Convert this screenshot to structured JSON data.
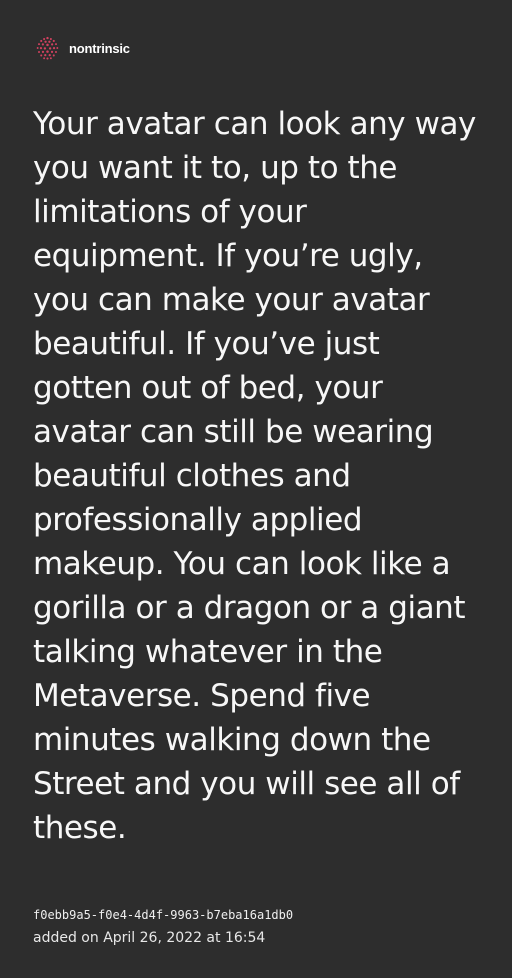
{
  "header": {
    "brand_name": "nontrinsic",
    "logo_icon": "pink-dotted-globe-icon",
    "logo_color": "#d1415f"
  },
  "post": {
    "text": "Your avatar can look any way you want it to, up to the limitations of your equipment. If you’re ugly, you can make your avatar beautiful. If you’ve just gotten out of bed, your avatar can still be wearing beautiful clothes and professionally applied makeup. You can look like a gorilla or a dragon or a giant talking whatever in the Metaverse. Spend five minutes walking down the Street and you will see all of these."
  },
  "footer": {
    "id": "f0ebb9a5-f0e4-4d4f-9963-b7eba16a1db0",
    "added_text": "added on April 26, 2022 at 16:54"
  },
  "colors": {
    "background": "#2d2d2d",
    "text": "#f7f7f7"
  }
}
